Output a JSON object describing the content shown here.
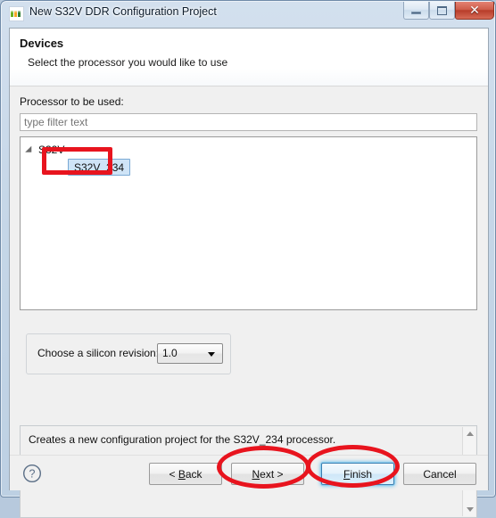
{
  "window": {
    "title": "New S32V DDR Configuration Project",
    "icon": "nxp-logo-icon",
    "controls": {
      "minimize_label": "Minimize",
      "maximize_label": "Maximize",
      "close_label": "✕"
    }
  },
  "header": {
    "title": "Devices",
    "subtitle": "Select the processor you would like to use"
  },
  "form": {
    "processor_label": "Processor to be used:",
    "filter_placeholder": "type filter text",
    "filter_value": ""
  },
  "tree": {
    "root_label": "S32V",
    "children": [
      {
        "label": "S32V_234",
        "selected": true
      }
    ]
  },
  "revision": {
    "label": "Choose a silicon revision:",
    "selected": "1.0",
    "options": [
      "1.0"
    ]
  },
  "description": {
    "text": "Creates a new configuration project for the S32V_234 processor."
  },
  "buttons": {
    "help": "?",
    "back": "< Back",
    "back_prefix": "< ",
    "back_mnemonic": "B",
    "back_suffix": "ack",
    "next_prefix": "",
    "next_mnemonic": "N",
    "next_suffix": "ext >",
    "finish_mnemonic": "F",
    "finish_suffix": "inish",
    "cancel": "Cancel"
  },
  "annotations": {
    "accent_color": "#e8141e",
    "items": [
      {
        "name": "tree-selection-highlight",
        "shape": "rectangle"
      },
      {
        "name": "next-button-highlight",
        "shape": "ellipse"
      },
      {
        "name": "finish-button-highlight",
        "shape": "ellipse"
      }
    ]
  }
}
